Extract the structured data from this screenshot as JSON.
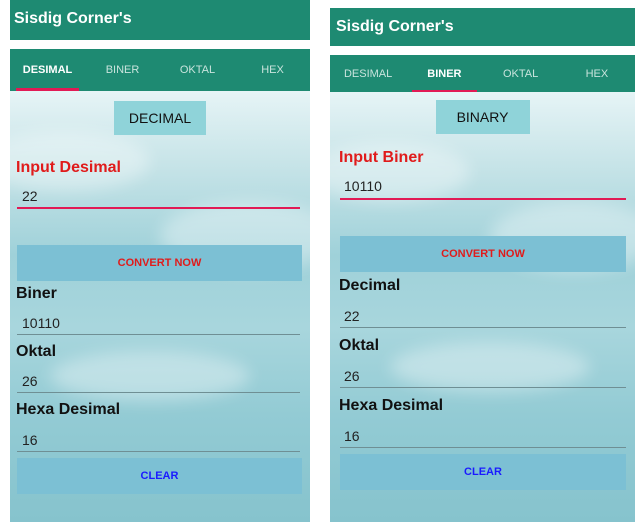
{
  "left_screen": {
    "app_title": "Sisdig Corner's",
    "tabs": [
      {
        "label": "DESIMAL",
        "active": true
      },
      {
        "label": "BINER",
        "active": false
      },
      {
        "label": "OKTAL",
        "active": false
      },
      {
        "label": "HEX",
        "active": false
      }
    ],
    "mode_label": "DECIMAL",
    "input_label": "Input Desimal",
    "input_value": "22",
    "convert_button": "CONVERT NOW",
    "outputs": [
      {
        "label": "Biner",
        "value": "10110"
      },
      {
        "label": "Oktal",
        "value": "26"
      },
      {
        "label": "Hexa Desimal",
        "value": "16"
      }
    ],
    "clear_button": "CLEAR"
  },
  "right_screen": {
    "app_title": "Sisdig Corner's",
    "tabs": [
      {
        "label": "DESIMAL",
        "active": false
      },
      {
        "label": "BINER",
        "active": true
      },
      {
        "label": "OKTAL",
        "active": false
      },
      {
        "label": "HEX",
        "active": false
      }
    ],
    "mode_label": "BINARY",
    "input_label": "Input Biner",
    "input_value": "10110",
    "convert_button": "CONVERT NOW",
    "outputs": [
      {
        "label": "Decimal",
        "value": "22"
      },
      {
        "label": "Oktal",
        "value": "26"
      },
      {
        "label": "Hexa Desimal",
        "value": "16"
      }
    ],
    "clear_button": "CLEAR"
  },
  "colors": {
    "app_bar": "#1e8a72",
    "tab_indicator": "#e11a55",
    "input_label": "#e01b1b",
    "button_bg": "#7cc0d4",
    "convert_text": "#e01b1b",
    "clear_text": "#1a1aff",
    "mode_badge": "#8fd3d9"
  }
}
